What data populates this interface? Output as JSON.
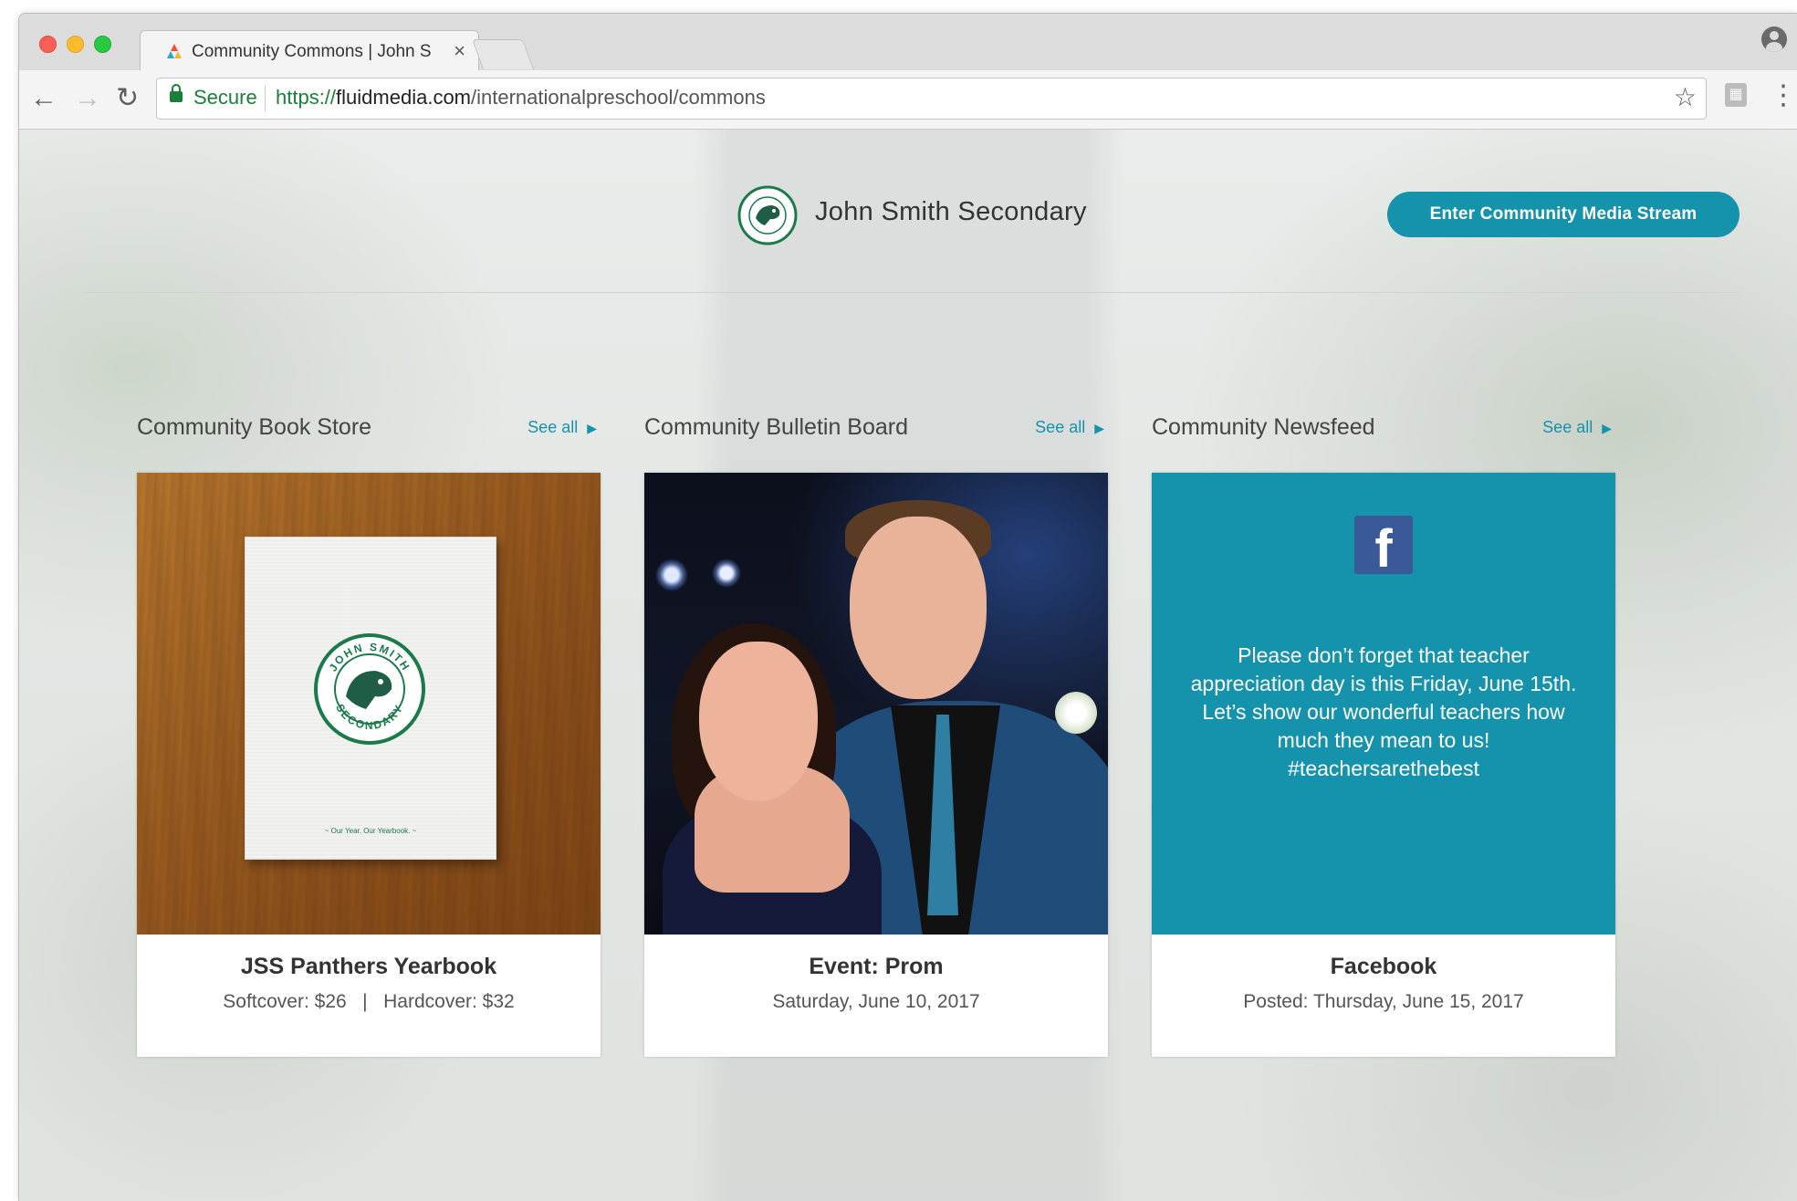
{
  "browser": {
    "tab_title": "Community Commons | John S",
    "tab_close": "×",
    "secure_label": "Secure",
    "url_scheme": "https://",
    "url_host": "fluidmedia.com",
    "url_path": "/internationalpreschool/commons",
    "icons": [
      "back-arrow-icon",
      "forward-arrow-icon",
      "reload-icon",
      "lock-icon",
      "star-icon",
      "extension-icon",
      "menu-kebab-icon",
      "profile-icon"
    ]
  },
  "header": {
    "school_name": "John Smith Secondary",
    "stream_button": "Enter Community Media Stream",
    "accent_color": "#1593ad"
  },
  "sections": [
    {
      "title": "Community Book Store",
      "see_all": "See all",
      "card_title": "JSS Panthers Yearbook",
      "card_subtitle": "Softcover: $26   |   Hardcover: $32",
      "book_seal_top": "JOHN SMITH",
      "book_seal_bottom": "SECONDARY",
      "book_tagline": "~ Our Year. Our Yearbook. ~"
    },
    {
      "title": "Community Bulletin Board",
      "see_all": "See all",
      "card_title": "Event: Prom",
      "card_subtitle": "Saturday, June 10, 2017"
    },
    {
      "title": "Community Newsfeed",
      "see_all": "See all",
      "card_title": "Facebook",
      "card_subtitle": "Posted: Thursday, June 15, 2017",
      "post_text": "Please don’t forget that teacher appreciation day is this Friday, June 15th. Let’s show our wonderful teachers how much they mean to us! #teachersarethebest",
      "fb_glyph": "f"
    }
  ]
}
